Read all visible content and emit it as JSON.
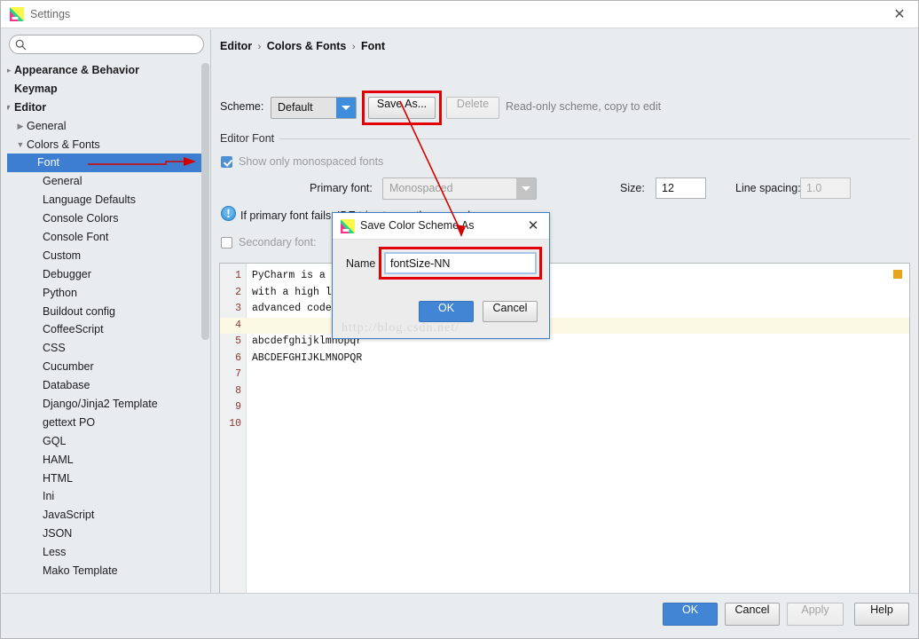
{
  "window": {
    "title": "Settings",
    "app_icon": "pycharm-icon",
    "close_label": "✕"
  },
  "search": {
    "placeholder": "",
    "value": "",
    "icon": "search-icon"
  },
  "sidebar": {
    "items": [
      {
        "label": "Appearance & Behavior",
        "indent": 0,
        "twisty": "collapsed",
        "bold": true,
        "selected": false
      },
      {
        "label": "Keymap",
        "indent": 0,
        "twisty": "none",
        "bold": true,
        "selected": false
      },
      {
        "label": "Editor",
        "indent": 0,
        "twisty": "expanded",
        "bold": true,
        "selected": false
      },
      {
        "label": "General",
        "indent": 1,
        "twisty": "collapsed",
        "bold": false,
        "selected": false
      },
      {
        "label": "Colors & Fonts",
        "indent": 1,
        "twisty": "expanded",
        "bold": false,
        "selected": false
      },
      {
        "label": "Font",
        "indent": 2,
        "twisty": "none",
        "bold": false,
        "selected": true
      },
      {
        "label": "General",
        "indent": 2,
        "twisty": "none",
        "bold": false,
        "selected": false
      },
      {
        "label": "Language Defaults",
        "indent": 2,
        "twisty": "none",
        "bold": false,
        "selected": false
      },
      {
        "label": "Console Colors",
        "indent": 2,
        "twisty": "none",
        "bold": false,
        "selected": false
      },
      {
        "label": "Console Font",
        "indent": 2,
        "twisty": "none",
        "bold": false,
        "selected": false
      },
      {
        "label": "Custom",
        "indent": 2,
        "twisty": "none",
        "bold": false,
        "selected": false
      },
      {
        "label": "Debugger",
        "indent": 2,
        "twisty": "none",
        "bold": false,
        "selected": false
      },
      {
        "label": "Python",
        "indent": 2,
        "twisty": "none",
        "bold": false,
        "selected": false
      },
      {
        "label": "Buildout config",
        "indent": 2,
        "twisty": "none",
        "bold": false,
        "selected": false
      },
      {
        "label": "CoffeeScript",
        "indent": 2,
        "twisty": "none",
        "bold": false,
        "selected": false
      },
      {
        "label": "CSS",
        "indent": 2,
        "twisty": "none",
        "bold": false,
        "selected": false
      },
      {
        "label": "Cucumber",
        "indent": 2,
        "twisty": "none",
        "bold": false,
        "selected": false
      },
      {
        "label": "Database",
        "indent": 2,
        "twisty": "none",
        "bold": false,
        "selected": false
      },
      {
        "label": "Django/Jinja2 Template",
        "indent": 2,
        "twisty": "none",
        "bold": false,
        "selected": false
      },
      {
        "label": "gettext PO",
        "indent": 2,
        "twisty": "none",
        "bold": false,
        "selected": false
      },
      {
        "label": "GQL",
        "indent": 2,
        "twisty": "none",
        "bold": false,
        "selected": false
      },
      {
        "label": "HAML",
        "indent": 2,
        "twisty": "none",
        "bold": false,
        "selected": false
      },
      {
        "label": "HTML",
        "indent": 2,
        "twisty": "none",
        "bold": false,
        "selected": false
      },
      {
        "label": "Ini",
        "indent": 2,
        "twisty": "none",
        "bold": false,
        "selected": false
      },
      {
        "label": "JavaScript",
        "indent": 2,
        "twisty": "none",
        "bold": false,
        "selected": false
      },
      {
        "label": "JSON",
        "indent": 2,
        "twisty": "none",
        "bold": false,
        "selected": false
      },
      {
        "label": "Less",
        "indent": 2,
        "twisty": "none",
        "bold": false,
        "selected": false
      },
      {
        "label": "Mako Template",
        "indent": 2,
        "twisty": "none",
        "bold": false,
        "selected": false
      }
    ]
  },
  "content": {
    "breadcrumb": {
      "part1": "Editor",
      "part2": "Colors & Fonts",
      "part3": "Font",
      "separator": "›"
    },
    "scheme": {
      "label": "Scheme:",
      "value": "Default",
      "save_as_label": "Save As...",
      "delete_label": "Delete",
      "readonly_note": "Read-only scheme, copy to edit"
    },
    "editor_font": {
      "group_label": "Editor Font",
      "monospaced_label": "Show only monospaced fonts",
      "monospaced_checked": true,
      "primary_font_label": "Primary font:",
      "primary_font_value": "Monospaced",
      "size_label": "Size:",
      "size_value": "12",
      "line_spacing_label": "Line spacing:",
      "line_spacing_value": "1.0",
      "info_text": "If primary font fails, IDE tries to use the secondary one",
      "info_icon": "info-icon",
      "secondary_font_label": "Secondary font:",
      "secondary_font_value": "",
      "secondary_checked": false
    },
    "preview": {
      "marker_color": "#e8a317",
      "lines": [
        {
          "num": "1",
          "text": "PyCharm is a full-"
        },
        {
          "num": "2",
          "text": "with a high level"
        },
        {
          "num": "3",
          "text": "advanced code edi"
        },
        {
          "num": "4",
          "text": ""
        },
        {
          "num": "5",
          "text": "abcdefghijklmnopqr"
        },
        {
          "num": "6",
          "text": "ABCDEFGHIJKLMNOPQR"
        },
        {
          "num": "7",
          "text": ""
        },
        {
          "num": "8",
          "text": ""
        },
        {
          "num": "9",
          "text": ""
        },
        {
          "num": "10",
          "text": ""
        }
      ]
    }
  },
  "footer": {
    "ok_label": "OK",
    "cancel_label": "Cancel",
    "apply_label": "Apply",
    "help_label": "Help"
  },
  "dialog": {
    "title": "Save Color Scheme As",
    "icon": "pycharm-icon",
    "close_label": "✕",
    "name_label": "Name",
    "name_value": "fontSize-NN",
    "name_placeholder": "",
    "ok_label": "OK",
    "cancel_label": "Cancel",
    "watermark": "http://blog.csdn.net/"
  },
  "annotations": {
    "highlight_color": "#e30000",
    "arrow_color": "#d40000"
  }
}
